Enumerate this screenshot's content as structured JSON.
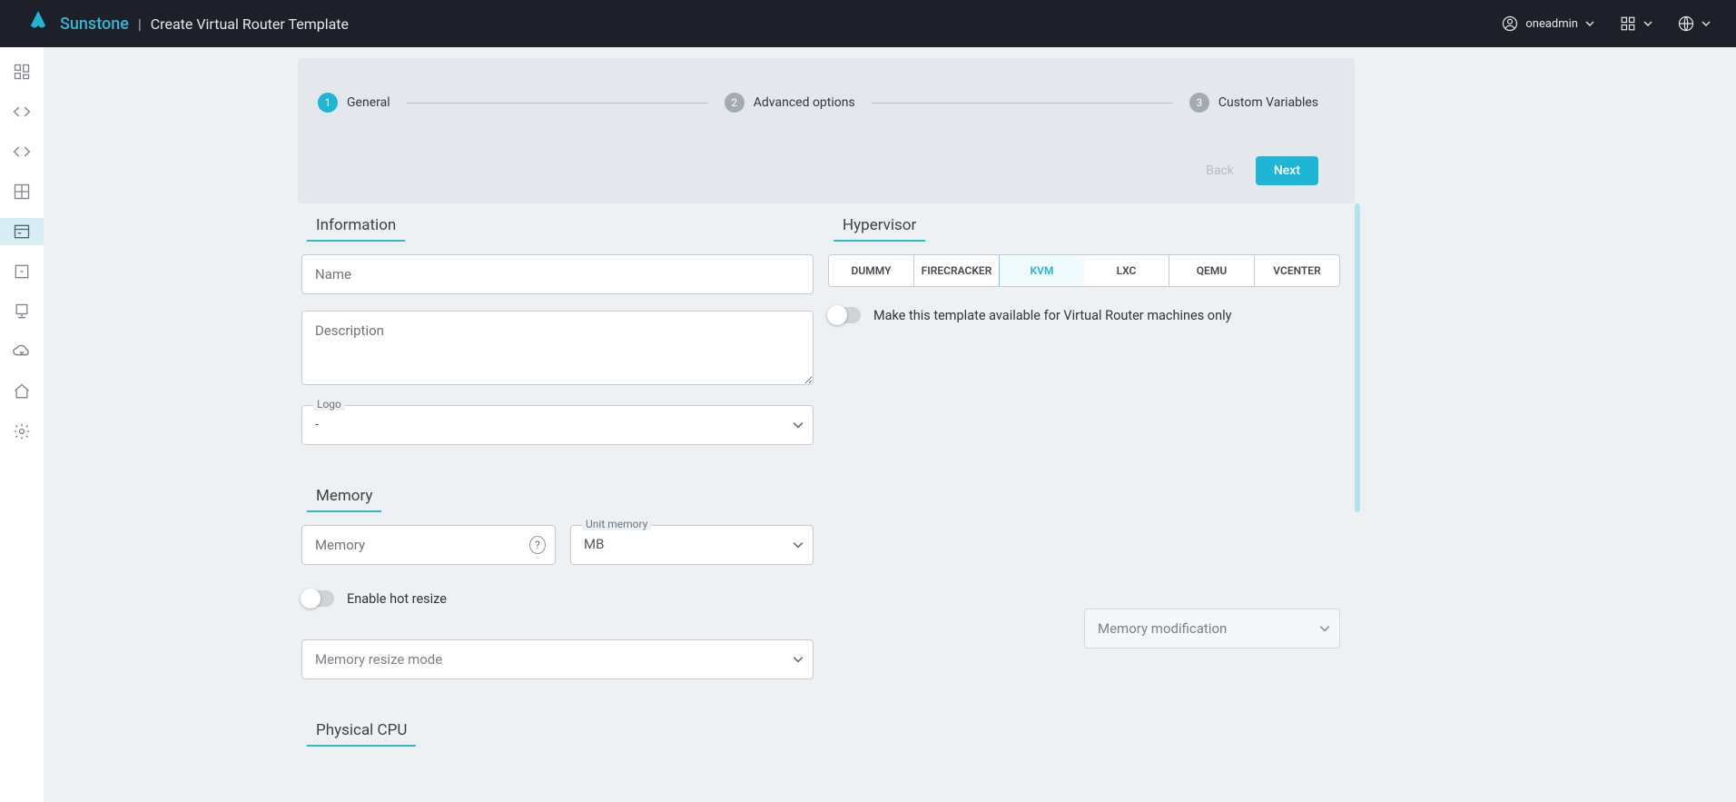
{
  "header": {
    "brand": "Sunstone",
    "separator": "|",
    "page_title": "Create Virtual Router Template",
    "user": "oneadmin"
  },
  "stepper": {
    "steps": [
      {
        "num": "1",
        "label": "General"
      },
      {
        "num": "2",
        "label": "Advanced options"
      },
      {
        "num": "3",
        "label": "Custom Variables"
      }
    ],
    "back": "Back",
    "next": "Next"
  },
  "sections": {
    "information": "Information",
    "hypervisor": "Hypervisor",
    "memory": "Memory",
    "physical_cpu": "Physical CPU"
  },
  "information": {
    "name_ph": "Name",
    "desc_ph": "Description",
    "logo_label": "Logo",
    "logo_value": "-"
  },
  "hypervisor": {
    "options": [
      "DUMMY",
      "FIRECRACKER",
      "KVM",
      "LXC",
      "QEMU",
      "VCENTER"
    ],
    "selected": "KVM",
    "vrouter_only": "Make this template available for Virtual Router machines only"
  },
  "memory": {
    "memory_ph": "Memory",
    "unit_label": "Unit memory",
    "unit_value": "MB",
    "hot_resize": "Enable hot resize",
    "mem_mod_ph": "Memory modification",
    "resize_mode_ph": "Memory resize mode"
  }
}
